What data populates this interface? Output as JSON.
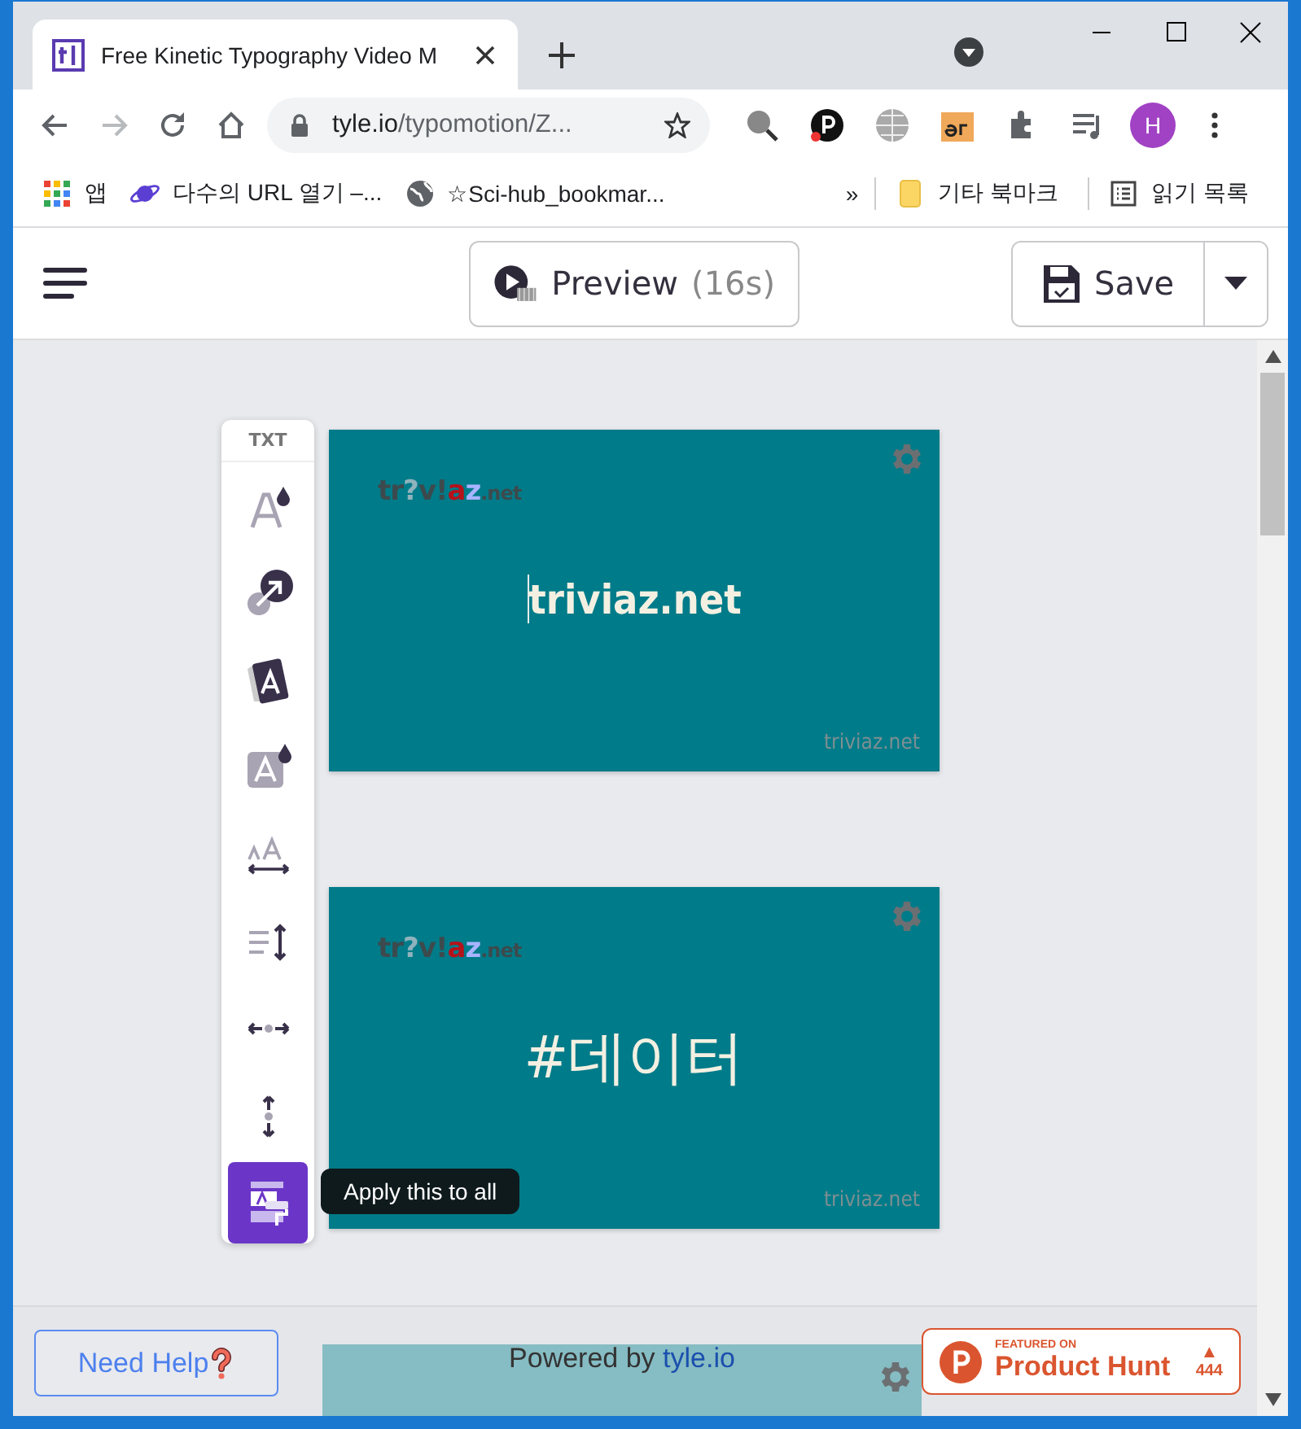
{
  "browser": {
    "tab_title": "Free Kinetic Typography Video M",
    "url_domain": "tyle.io",
    "url_path": "/typomotion/Z...",
    "profile_initial": "H",
    "bookmarks": [
      {
        "kind": "apps",
        "label": "앱"
      },
      {
        "kind": "planet",
        "label": "다수의 URL 열기 –..."
      },
      {
        "kind": "globe",
        "label": "☆Sci-hub_bookmar..."
      }
    ],
    "more": "»",
    "other_bookmarks": "기타 북마크",
    "reading_list": "읽기 목록"
  },
  "header": {
    "preview": "Preview",
    "duration": "(16s)",
    "save": "Save"
  },
  "toolbox": {
    "label": "TXT",
    "tooltip": "Apply this to all",
    "tools": [
      {
        "kind": "font-color",
        "selected": false
      },
      {
        "kind": "link",
        "selected": false
      },
      {
        "kind": "card",
        "selected": false
      },
      {
        "kind": "bg-color",
        "selected": false
      },
      {
        "kind": "letter-spacing",
        "selected": false
      },
      {
        "kind": "line-height",
        "selected": false
      },
      {
        "kind": "h-spread",
        "selected": false
      },
      {
        "kind": "v-spread",
        "selected": false
      },
      {
        "kind": "apply-all",
        "selected": true
      }
    ]
  },
  "scenes": [
    {
      "logo": [
        {
          "text": "tr",
          "color": "#3d4a4d"
        },
        {
          "text": "?",
          "color": "#8fb3bd"
        },
        {
          "text": "v!",
          "color": "#3d4a4d"
        },
        {
          "text": "a",
          "color": "#b5121b"
        },
        {
          "text": "z",
          "color": "#a8b4ff"
        },
        {
          "text": ".net",
          "color": "#3d4a4d"
        }
      ],
      "text": "triviaz.net",
      "watermark": "triviaz.net",
      "cursor": true
    },
    {
      "logo": [
        {
          "text": "tr",
          "color": "#3d4a4d"
        },
        {
          "text": "?",
          "color": "#8fb3bd"
        },
        {
          "text": "v!",
          "color": "#3d4a4d"
        },
        {
          "text": "a",
          "color": "#b5121b"
        },
        {
          "text": "z",
          "color": "#a8b4ff"
        },
        {
          "text": ".net",
          "color": "#3d4a4d"
        }
      ],
      "text": "#데이터",
      "watermark": "triviaz.net",
      "cursor": false
    }
  ],
  "footer": {
    "help": "Need Help",
    "powered_by": "Powered by",
    "powered_link": "tyle.io",
    "ph_featured": "FEATURED ON",
    "ph_name": "Product Hunt",
    "ph_arrow": "▲",
    "ph_votes": "444"
  }
}
